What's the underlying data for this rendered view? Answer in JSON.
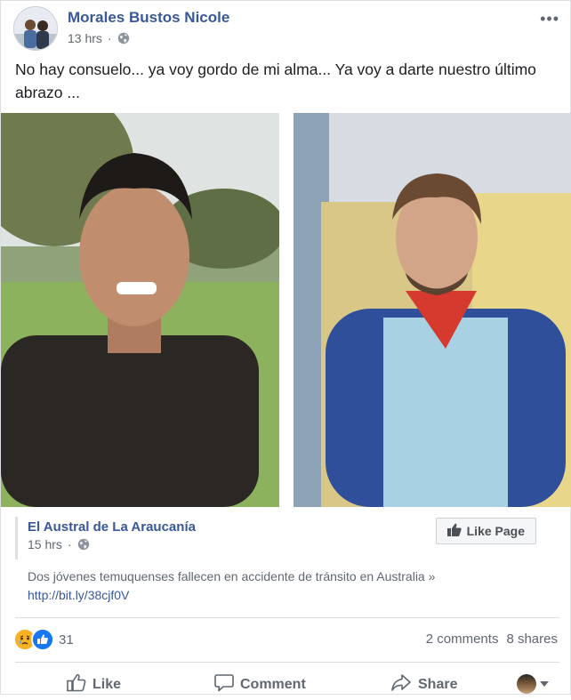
{
  "post": {
    "author": "Morales Bustos Nicole",
    "time": "13 hrs",
    "more_label": "•••",
    "caption": "No hay consuelo... ya voy gordo de mi alma... Ya voy a darte nuestro último abrazo ..."
  },
  "link": {
    "source": "El Austral de La Araucanía",
    "time": "15 hrs",
    "like_page_label": "Like Page",
    "description": "Dos jóvenes temuquenses fallecen en accidente de tránsito en Australia »",
    "url": "http://bit.ly/38cjf0V"
  },
  "stats": {
    "reaction_count": "31",
    "comments": "2 comments",
    "shares": "8 shares"
  },
  "actions": {
    "like": "Like",
    "comment": "Comment",
    "share": "Share"
  },
  "icons": {
    "globe": "globe-icon",
    "like_thumb": "thumbs-up-icon",
    "comment": "speech-bubble-icon",
    "share": "share-arrow-icon",
    "sad": "sad-reaction-icon",
    "like_reaction": "like-reaction-icon"
  },
  "colors": {
    "link_blue": "#385898",
    "secondary_text": "#606770",
    "like_reaction": "#1877f2",
    "sad_reaction": "#f7b125"
  }
}
